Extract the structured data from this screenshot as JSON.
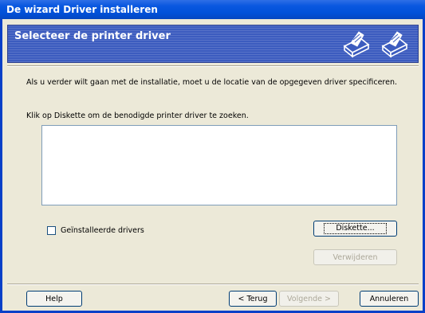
{
  "window": {
    "title": "De wizard Driver installeren"
  },
  "banner": {
    "title": "Selecteer de printer driver"
  },
  "body": {
    "instruction": "Als u verder wilt gaan met de installatie, moet u de locatie van de opgegeven driver specificeren.",
    "prompt": "Klik op Diskette om de benodigde printer driver te zoeken."
  },
  "checkbox": {
    "label": "Geïnstalleerde drivers",
    "checked": false
  },
  "buttons": {
    "diskette": "Diskette...",
    "remove": "Verwijderen",
    "help": "Help",
    "back": "< Terug",
    "next": "Volgende >",
    "cancel": "Annuleren"
  },
  "icons": [
    "printer-icon",
    "printer-icon"
  ]
}
